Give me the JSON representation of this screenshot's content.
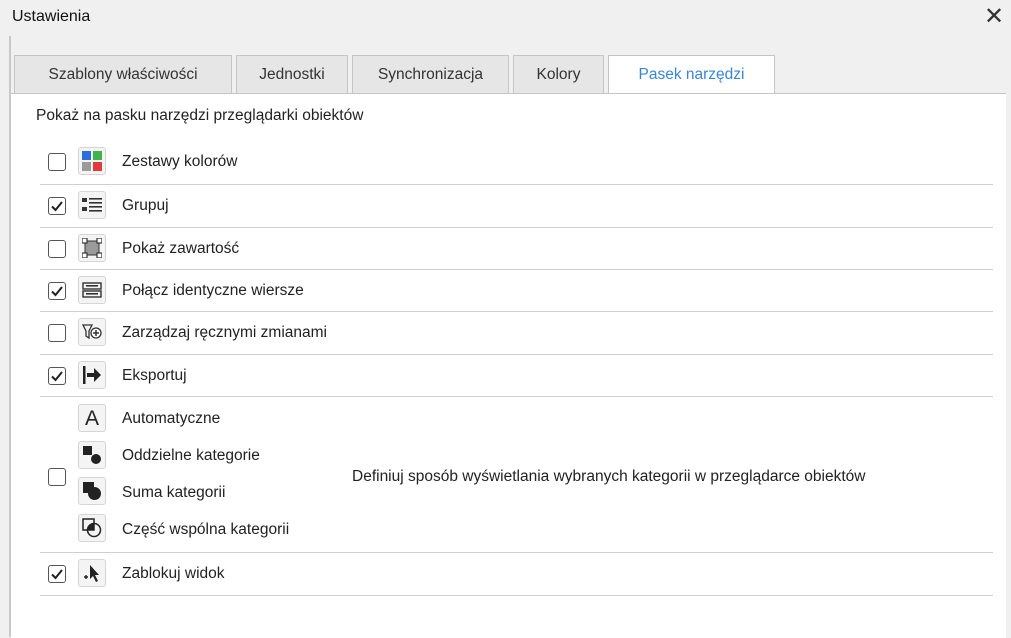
{
  "window": {
    "title": "Ustawienia"
  },
  "tabs": [
    {
      "label": "Szablony właściwości",
      "active": false
    },
    {
      "label": "Jednostki",
      "active": false
    },
    {
      "label": "Synchronizacja",
      "active": false
    },
    {
      "label": "Kolory",
      "active": false
    },
    {
      "label": "Pasek narzędzi",
      "active": true
    }
  ],
  "toolbar_settings": {
    "heading": "Pokaż na pasku narzędzi przeglądarki obiektów",
    "items": [
      {
        "label": "Zestawy kolorów",
        "checked": false,
        "icon": "color-sets-icon"
      },
      {
        "label": "Grupuj",
        "checked": true,
        "icon": "group-icon"
      },
      {
        "label": "Pokaż zawartość",
        "checked": false,
        "icon": "show-content-icon"
      },
      {
        "label": "Połącz identyczne wiersze",
        "checked": true,
        "icon": "merge-rows-icon"
      },
      {
        "label": "Zarządzaj ręcznymi zmianami",
        "checked": false,
        "icon": "manual-changes-icon"
      },
      {
        "label": "Eksportuj",
        "checked": true,
        "icon": "export-icon"
      }
    ],
    "category_group": {
      "checked": false,
      "options": [
        {
          "label": "Automatyczne",
          "icon": "letter-a-icon"
        },
        {
          "label": "Oddzielne kategorie",
          "icon": "separate-categories-icon"
        },
        {
          "label": "Suma kategorii",
          "icon": "union-categories-icon"
        },
        {
          "label": "Część wspólna kategorii",
          "icon": "intersection-categories-icon"
        }
      ],
      "description": "Definiuj sposób wyświetlania wybranych kategorii w przeglądarce obiektów"
    },
    "last_item": {
      "label": "Zablokuj widok",
      "checked": true,
      "icon": "lock-view-icon"
    }
  },
  "colors": {
    "active_tab_text": "#3a86d6",
    "tile_blue": "#2a6fdb",
    "tile_green": "#3fb44a",
    "tile_red": "#e23b3b",
    "tile_gray": "#9a9a9a"
  }
}
